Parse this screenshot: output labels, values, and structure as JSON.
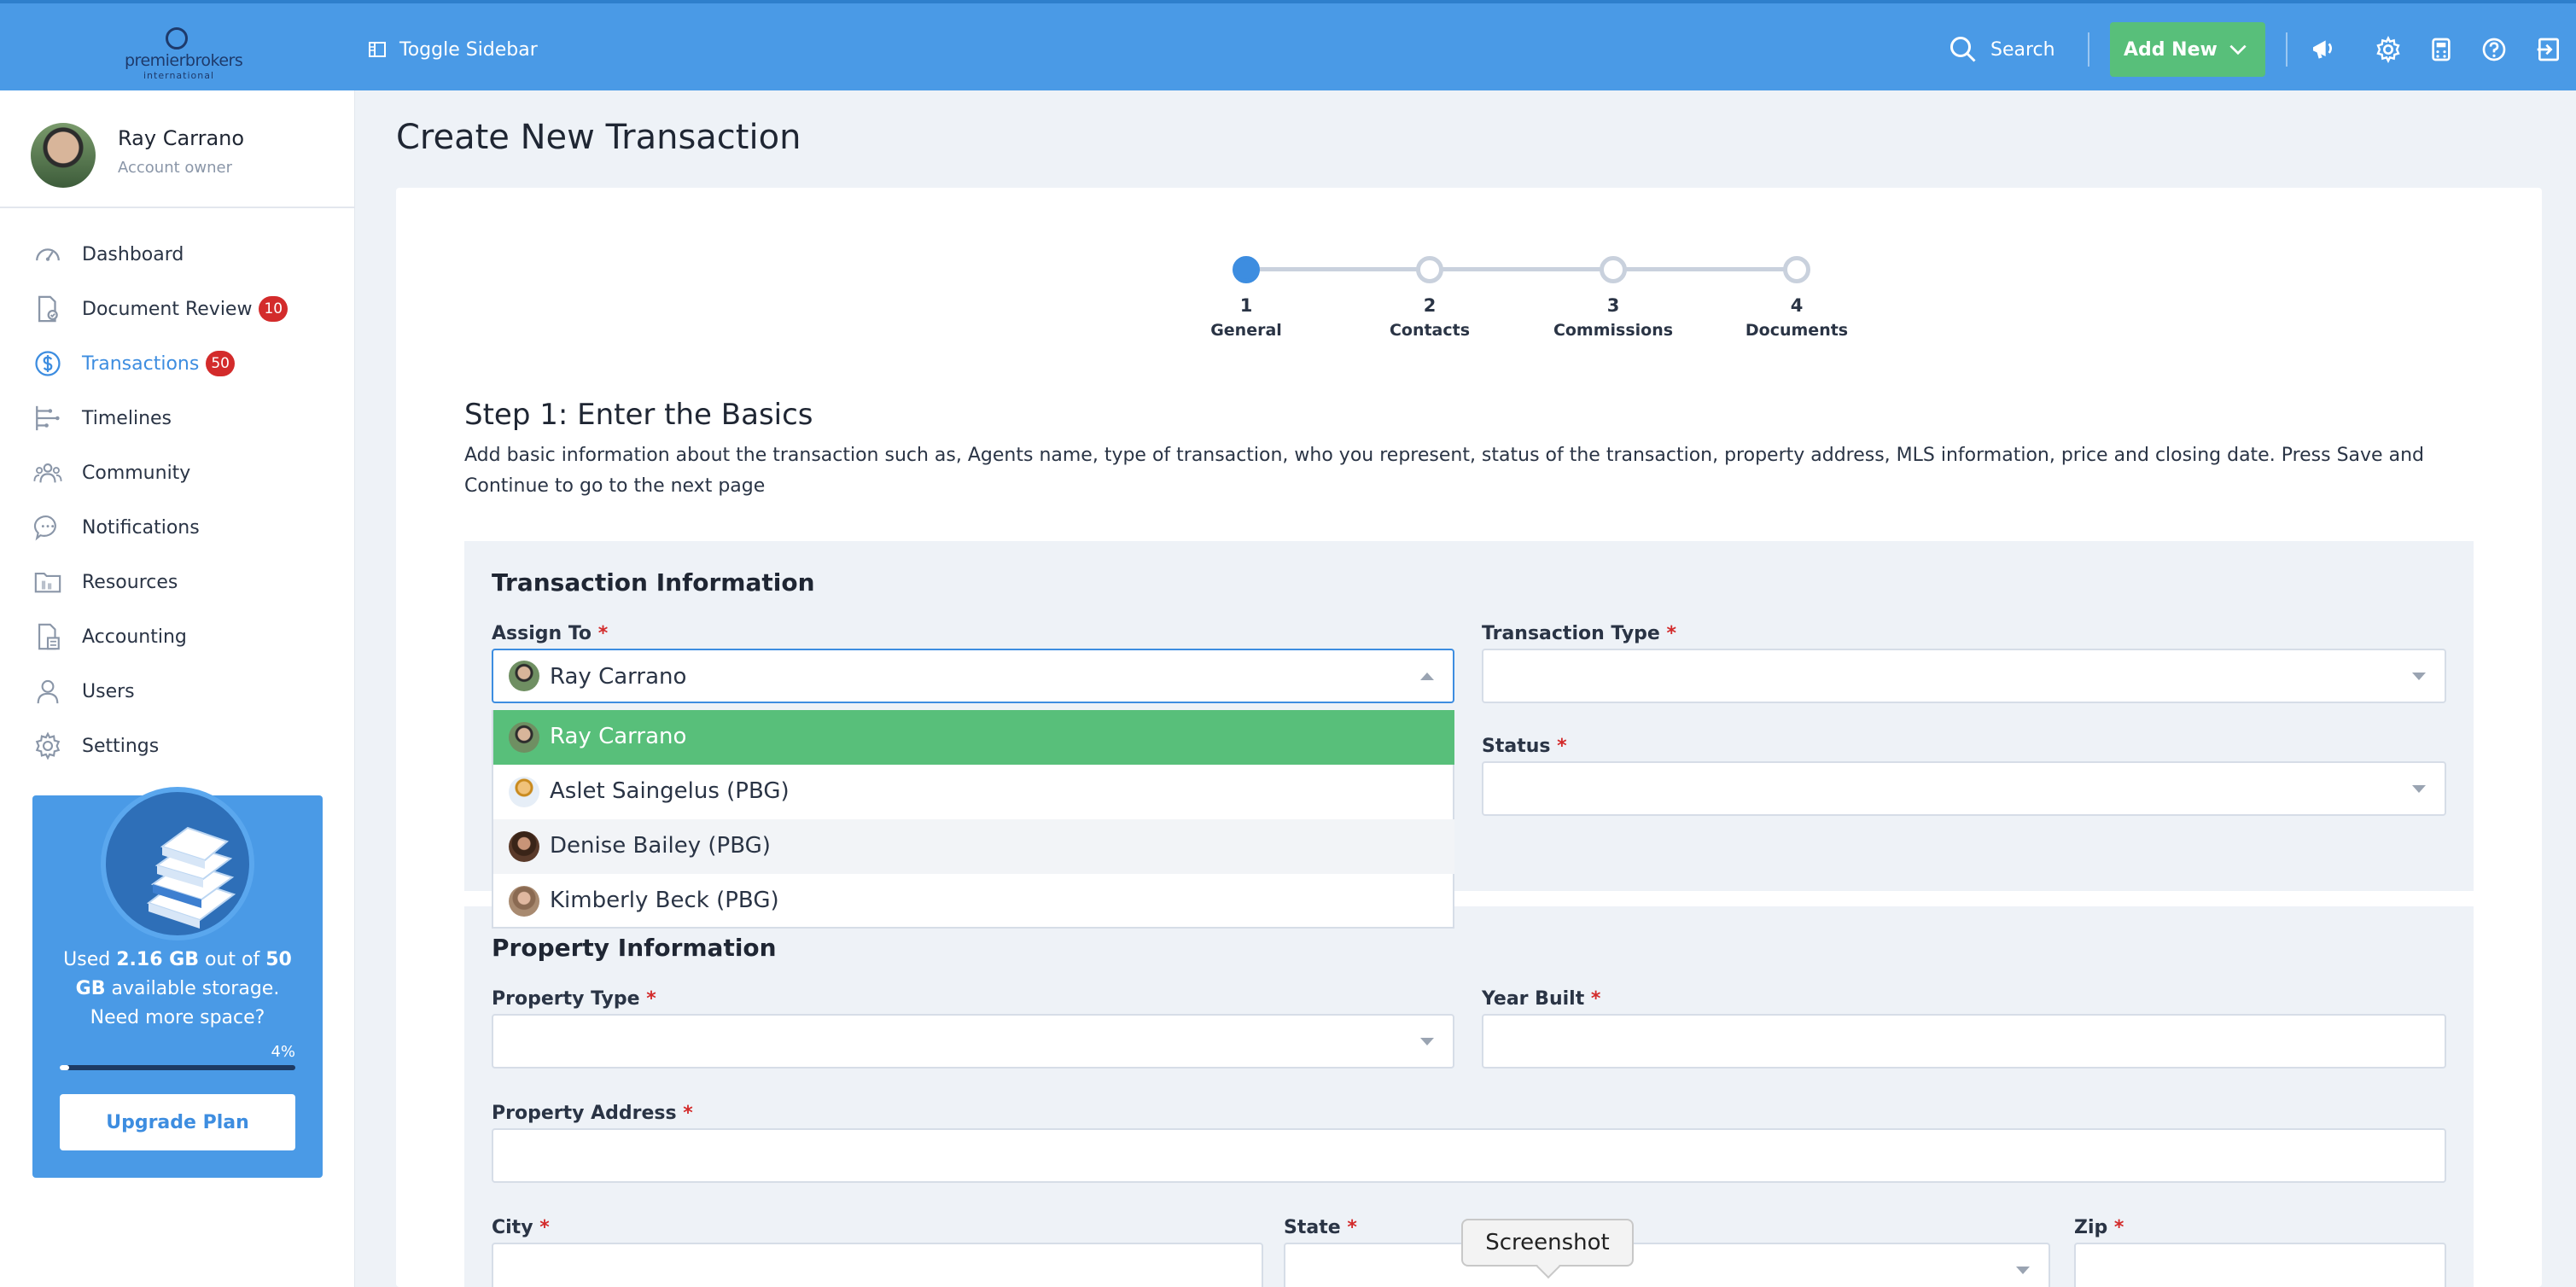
{
  "app": {
    "logo_line1": "premierbrokers",
    "logo_line2": "international"
  },
  "topbar": {
    "toggle_label": "Toggle Sidebar",
    "search_label": "Search",
    "add_new_label": "Add New"
  },
  "user": {
    "name": "Ray Carrano",
    "role": "Account owner"
  },
  "sidebar": {
    "items": [
      {
        "label": "Dashboard",
        "icon": "dashboard-icon",
        "badge": ""
      },
      {
        "label": "Document Review",
        "icon": "document-review-icon",
        "badge": "10"
      },
      {
        "label": "Transactions",
        "icon": "dollar-icon",
        "badge": "50"
      },
      {
        "label": "Timelines",
        "icon": "timeline-icon",
        "badge": ""
      },
      {
        "label": "Community",
        "icon": "community-icon",
        "badge": ""
      },
      {
        "label": "Notifications",
        "icon": "chat-bubble-icon",
        "badge": ""
      },
      {
        "label": "Resources",
        "icon": "folder-icon",
        "badge": ""
      },
      {
        "label": "Accounting",
        "icon": "accounting-icon",
        "badge": ""
      },
      {
        "label": "Users",
        "icon": "user-icon",
        "badge": ""
      },
      {
        "label": "Settings",
        "icon": "gear-icon",
        "badge": ""
      }
    ],
    "active_index": 2
  },
  "storage": {
    "used_prefix": "Used",
    "used_amount": "2.16 GB",
    "out_of": "out of",
    "total": "50 GB",
    "suffix": "available storage.",
    "question": "Need more space?",
    "percent_label": "4%",
    "percent": 4,
    "upgrade_label": "Upgrade Plan"
  },
  "page": {
    "title": "Create New Transaction"
  },
  "stepper": {
    "steps": [
      {
        "number": "1",
        "label": "General",
        "done": true
      },
      {
        "number": "2",
        "label": "Contacts",
        "done": false
      },
      {
        "number": "3",
        "label": "Commissions",
        "done": false
      },
      {
        "number": "4",
        "label": "Documents",
        "done": false
      }
    ]
  },
  "step": {
    "title": "Step 1: Enter the Basics",
    "description": "Add basic information about the transaction such as, Agents name, type of transaction, who you represent, status of the transaction, property address, MLS information, price and closing date. Press Save and Continue to go to the next page"
  },
  "transaction_info": {
    "title": "Transaction Information",
    "assign_to_label": "Assign To",
    "assign_to_value": "Ray Carrano",
    "transaction_type_label": "Transaction Type",
    "status_label": "Status",
    "required_mark": "*",
    "options": [
      "Ray Carrano",
      "Aslet Saingelus (PBG)",
      "Denise Bailey (PBG)",
      "Kimberly Beck (PBG)"
    ]
  },
  "property_info": {
    "title": "Property Information",
    "property_type_label": "Property Type",
    "year_built_label": "Year Built",
    "address_label": "Property Address",
    "city_label": "City",
    "state_label": "State",
    "zip_label": "Zip"
  },
  "tooltip": {
    "text": "Screenshot"
  },
  "colors": {
    "topbar": "#4a9ae6",
    "accent": "#3d8de0",
    "success": "#58bf7a",
    "badge": "#d32b2b"
  }
}
